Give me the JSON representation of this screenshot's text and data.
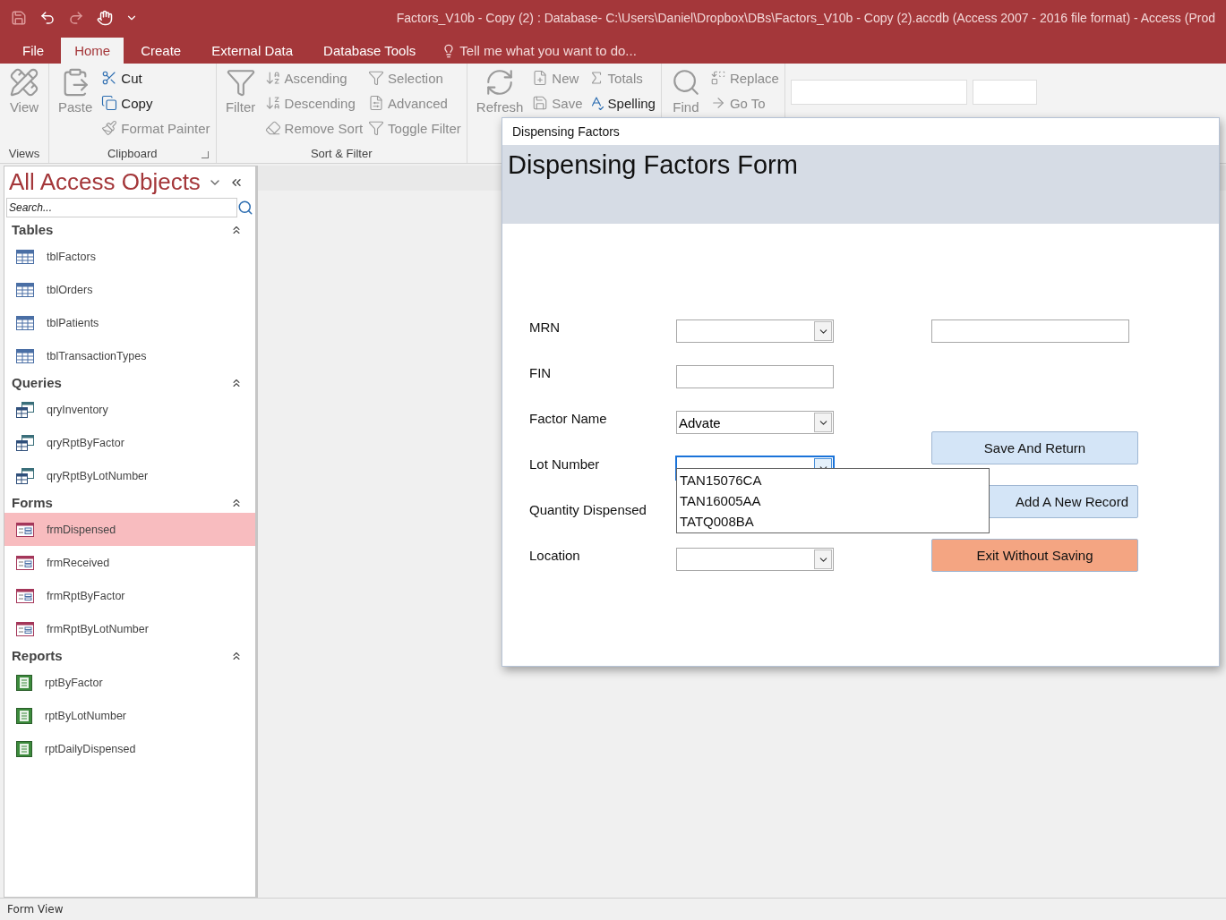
{
  "window": {
    "title": "Factors_V10b - Copy (2) : Database- C:\\Users\\Daniel\\Dropbox\\DBs\\Factors_V10b - Copy (2).accdb (Access 2007 - 2016 file format) - Access (Prod"
  },
  "ribbon_tabs": [
    {
      "label": "File",
      "selected": false
    },
    {
      "label": "Home",
      "selected": true
    },
    {
      "label": "Create",
      "selected": false
    },
    {
      "label": "External Data",
      "selected": false
    },
    {
      "label": "Database Tools",
      "selected": false
    }
  ],
  "tell_me": "Tell me what you want to do...",
  "ribbon_groups": [
    {
      "label": "Views",
      "items": [
        {
          "kind": "large",
          "label": "View",
          "disabled": true
        }
      ]
    },
    {
      "label": "Clipboard",
      "launcher": true,
      "items": [
        {
          "kind": "large",
          "label": "Paste",
          "disabled": true
        },
        {
          "kind": "column",
          "items": [
            {
              "label": "Cut",
              "disabled": false
            },
            {
              "label": "Copy",
              "disabled": false
            },
            {
              "label": "Format Painter",
              "disabled": true
            }
          ]
        }
      ]
    },
    {
      "label": "Sort & Filter",
      "items": [
        {
          "kind": "large",
          "label": "Filter",
          "disabled": true
        },
        {
          "kind": "column",
          "items": [
            {
              "label": "Ascending",
              "disabled": true
            },
            {
              "label": "Descending",
              "disabled": true
            },
            {
              "label": "Remove Sort",
              "disabled": true
            }
          ]
        },
        {
          "kind": "column",
          "items": [
            {
              "label": "Selection",
              "disabled": true
            },
            {
              "label": "Advanced",
              "disabled": true
            },
            {
              "label": "Toggle Filter",
              "disabled": true
            }
          ]
        }
      ]
    },
    {
      "items": [
        {
          "kind": "large",
          "label": "Refresh",
          "disabled": true
        },
        {
          "kind": "column",
          "items": [
            {
              "label": "New",
              "disabled": true
            },
            {
              "label": "Save",
              "disabled": true
            }
          ]
        },
        {
          "kind": "column",
          "items": [
            {
              "label": "Totals",
              "disabled": true
            },
            {
              "label": "Spelling",
              "disabled": false
            }
          ]
        }
      ]
    },
    {
      "items": [
        {
          "kind": "large",
          "label": "Find",
          "disabled": true
        },
        {
          "kind": "column",
          "items": [
            {
              "label": "Replace",
              "disabled": true
            },
            {
              "label": "Go To",
              "disabled": true
            }
          ]
        }
      ]
    }
  ],
  "nav": {
    "title": "All Access Objects",
    "search": {
      "placeholder": "Search..."
    },
    "groups": [
      {
        "label": "Tables",
        "kind": "table",
        "items": [
          {
            "label": "tblFactors",
            "selected": false
          },
          {
            "label": "tblOrders",
            "selected": false
          },
          {
            "label": "tblPatients",
            "selected": false
          },
          {
            "label": "tblTransactionTypes",
            "selected": false
          }
        ]
      },
      {
        "label": "Queries",
        "kind": "query",
        "items": [
          {
            "label": "qryInventory",
            "selected": false
          },
          {
            "label": "qryRptByFactor",
            "selected": false
          },
          {
            "label": "qryRptByLotNumber",
            "selected": false
          }
        ]
      },
      {
        "label": "Forms",
        "kind": "form",
        "items": [
          {
            "label": "frmDispensed",
            "selected": true
          },
          {
            "label": "frmReceived",
            "selected": false
          },
          {
            "label": "frmRptByFactor",
            "selected": false
          },
          {
            "label": "frmRptByLotNumber",
            "selected": false
          }
        ]
      },
      {
        "label": "Reports",
        "kind": "report",
        "items": [
          {
            "label": "rptByFactor",
            "selected": false
          },
          {
            "label": "rptByLotNumber",
            "selected": false
          },
          {
            "label": "rptDailyDispensed",
            "selected": false
          }
        ]
      }
    ]
  },
  "form_window": {
    "title": "Dispensing Factors",
    "header": "Dispensing Factors Form",
    "fields": [
      {
        "label": "MRN",
        "kind": "combo",
        "focused": false
      },
      {
        "label": "FIN",
        "kind": "text",
        "focused": false
      },
      {
        "label": "Factor Name",
        "kind": "combo",
        "value": "Advate",
        "focused": false
      },
      {
        "label": "Lot Number",
        "kind": "combo",
        "focused": true
      },
      {
        "label": "Quantity Dispensed",
        "kind": "hidden"
      },
      {
        "label": "Location",
        "kind": "combo",
        "focused": false
      }
    ],
    "lot_dropdown": [
      "TAN15076CA",
      "TAN16005AA",
      "TATQ008BA"
    ],
    "buttons": [
      {
        "label": "Save And Return",
        "color": "#d4e5f7"
      },
      {
        "label": "Add A New Record",
        "color": "#d4e5f7"
      },
      {
        "label": "Exit Without Saving",
        "color": "#f4a582"
      }
    ]
  },
  "status_bar": "Form View"
}
